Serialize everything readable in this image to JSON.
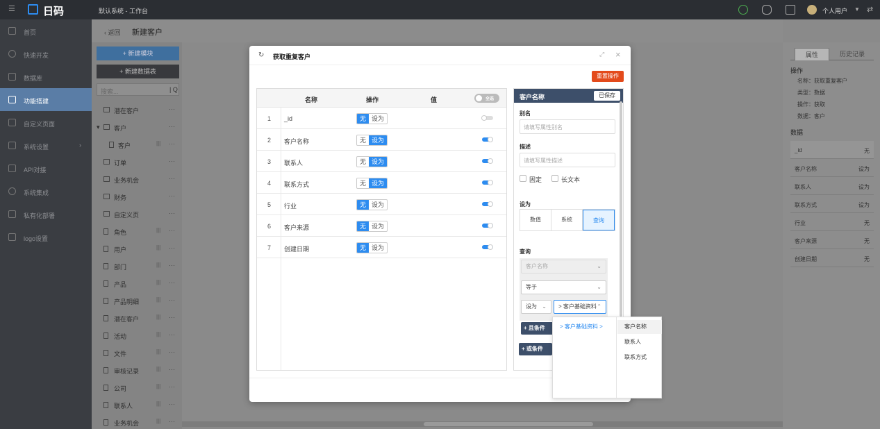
{
  "app": {
    "logo_text": "日码",
    "system_title": "默认系统 - 工作台",
    "user_name": "个人用户"
  },
  "nav": [
    {
      "label": "首页",
      "icon": "home-icon"
    },
    {
      "label": "快速开发",
      "icon": "rocket-icon"
    },
    {
      "label": "数据库",
      "icon": "database-icon"
    },
    {
      "label": "功能搭建",
      "icon": "build-icon",
      "active": true
    },
    {
      "label": "自定义页面",
      "icon": "page-icon"
    },
    {
      "label": "系统设置",
      "icon": "monitor-icon"
    },
    {
      "label": "API对接",
      "icon": "api-icon"
    },
    {
      "label": "系统集成",
      "icon": "integration-icon"
    },
    {
      "label": "私有化部署",
      "icon": "deploy-icon"
    },
    {
      "label": "logo设置",
      "icon": "logo-icon"
    }
  ],
  "breadcrumb": {
    "back": "返回",
    "title": "新建客户"
  },
  "tree": {
    "new_module": "+ 新建模块",
    "new_table": "+ 新建数据表",
    "search_placeholder": "搜索...",
    "items": [
      "潜在客户",
      "客户",
      "客户",
      "订单",
      "业务机会",
      "财务",
      "自定义页",
      "角色",
      "用户",
      "部门",
      "产品",
      "产品明细",
      "潜在客户",
      "活动",
      "文件",
      "审核记录",
      "公司",
      "联系人",
      "业务机会"
    ]
  },
  "right_panel": {
    "tab_props": "属性",
    "tab_history": "历史记录",
    "ops_heading": "操作",
    "ops_lines": [
      "名称：获取重复客户",
      "类型：数据",
      "操作：获取",
      "数据：客户"
    ],
    "data_heading": "数据",
    "data_rows": [
      {
        "k": "_id",
        "v": "无"
      },
      {
        "k": "客户名称",
        "v": "设为"
      },
      {
        "k": "联系人",
        "v": "设为"
      },
      {
        "k": "联系方式",
        "v": "设为"
      },
      {
        "k": "行业",
        "v": "无"
      },
      {
        "k": "客户来源",
        "v": "无"
      },
      {
        "k": "创建日期",
        "v": "无"
      }
    ]
  },
  "modal": {
    "title": "获取重复客户",
    "reset_button": "重置操作",
    "columns": {
      "name": "名称",
      "op": "操作",
      "value": "值",
      "toggle": "全选"
    },
    "rows": [
      {
        "n": "1",
        "name": "_id",
        "none": "无",
        "set": "设为",
        "mode": "none",
        "on": false
      },
      {
        "n": "2",
        "name": "客户名称",
        "none": "无",
        "set": "设为",
        "mode": "set",
        "on": true
      },
      {
        "n": "3",
        "name": "联系人",
        "none": "无",
        "set": "设为",
        "mode": "set",
        "on": true
      },
      {
        "n": "4",
        "name": "联系方式",
        "none": "无",
        "set": "设为",
        "mode": "set",
        "on": true
      },
      {
        "n": "5",
        "name": "行业",
        "none": "无",
        "set": "设为",
        "mode": "none",
        "on": true
      },
      {
        "n": "6",
        "name": "客户来源",
        "none": "无",
        "set": "设为",
        "mode": "none",
        "on": true
      },
      {
        "n": "7",
        "name": "创建日期",
        "none": "无",
        "set": "设为",
        "mode": "none",
        "on": true
      }
    ],
    "props": {
      "title": "客户名称",
      "saved": "已保存",
      "alias_label": "别名",
      "alias_placeholder": "请填写属性别名",
      "desc_label": "描述",
      "desc_placeholder": "请填写属性描述",
      "fixed": "固定",
      "longtext": "长文本",
      "set_as_label": "设为",
      "set_as": [
        "数值",
        "系统",
        "查询"
      ],
      "query_label": "查询",
      "query_field": "客户名称",
      "operator": "等于",
      "value_type": "设为",
      "value_path": "> 客户基础资料",
      "and_button": "+ 且条件",
      "or_button": "+ 或条件"
    },
    "cascader": {
      "level1": "> 客户基础资料 >",
      "level2": [
        "客户名称",
        "联系人",
        "联系方式"
      ]
    }
  },
  "colors": {
    "primary": "#2d8cf0",
    "danger": "#e34a1b",
    "header": "#3d4f6a"
  }
}
